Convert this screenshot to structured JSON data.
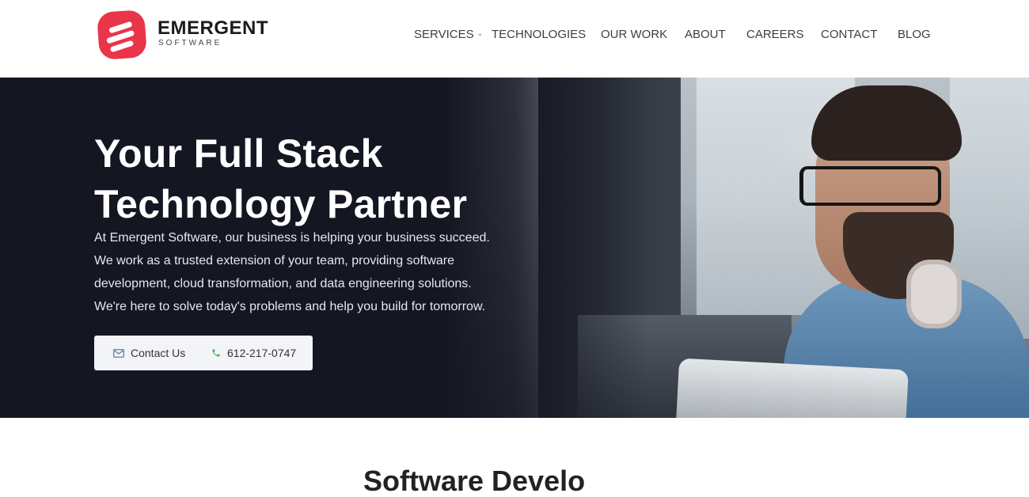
{
  "header": {
    "logo": {
      "name": "EMERGENT",
      "subtitle": "SOFTWARE",
      "color": "#e8354a"
    },
    "nav": [
      {
        "label": "SERVICES",
        "has_dropdown": true
      },
      {
        "label": "TECHNOLOGIES"
      },
      {
        "label": "OUR WORK"
      },
      {
        "label": "ABOUT"
      },
      {
        "label": "CAREERS"
      },
      {
        "label": "CONTACT"
      },
      {
        "label": "BLOG"
      }
    ]
  },
  "hero": {
    "title_line1": "Your Full Stack",
    "title_line2": "Technology Partner",
    "description_lines": [
      "At Emergent Software, our business is helping your business succeed.",
      "We work as a trusted extension of your team, providing software",
      "development, cloud transformation, and data engineering solutions.",
      "We're here to solve today's problems and help you build for tomorrow."
    ],
    "cta": {
      "contact_label": "Contact Us",
      "contact_icon": "envelope-icon",
      "phone_label": "612-217-0747",
      "phone_icon": "phone-icon",
      "phone_icon_color": "#3cb54a"
    },
    "background_color": "#141622"
  },
  "next_section": {
    "heading_partial": "Software Develo"
  }
}
